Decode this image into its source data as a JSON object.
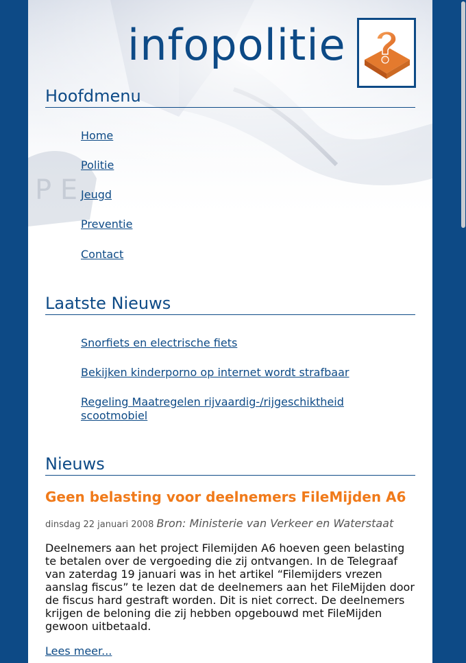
{
  "header": {
    "site_title": "infopolitie",
    "logo_icon": "question-mark-icon"
  },
  "main_menu": {
    "heading": "Hoofdmenu",
    "items": [
      {
        "label": "Home"
      },
      {
        "label": "Politie"
      },
      {
        "label": "Jeugd"
      },
      {
        "label": "Preventie"
      },
      {
        "label": "Contact"
      }
    ]
  },
  "latest_news": {
    "heading": "Laatste Nieuws",
    "items": [
      {
        "label": "Snorfiets en electrische fiets"
      },
      {
        "label": "Bekijken kinderporno op internet wordt strafbaar"
      },
      {
        "label": "Regeling Maatregelen rijvaardig-/rijgeschiktheid scootmobiel"
      }
    ]
  },
  "news": {
    "heading": "Nieuws",
    "article": {
      "title": "Geen belasting voor deelnemers FileMijden A6",
      "date": "dinsdag 22 januari 2008",
      "source": "Bron: Ministerie van Verkeer en Waterstaat",
      "body": "Deelnemers aan het project Filemijden A6 hoeven geen belasting te betalen over de vergoeding die zij ontvangen. In de Telegraaf van zaterdag 19 januari was in het artikel “Filemijders vrezen aanslag fiscus” te lezen dat de deelnemers aan het FileMijden door de fiscus hard gestraft worden. Dit is niet correct. De deelnemers krijgen de beloning die zij hebben opgebouwd met FileMijden gewoon uitbetaald.",
      "read_more": "Lees meer..."
    }
  },
  "colors": {
    "brand_blue": "#0d4a86",
    "accent_orange": "#f07a1a"
  }
}
